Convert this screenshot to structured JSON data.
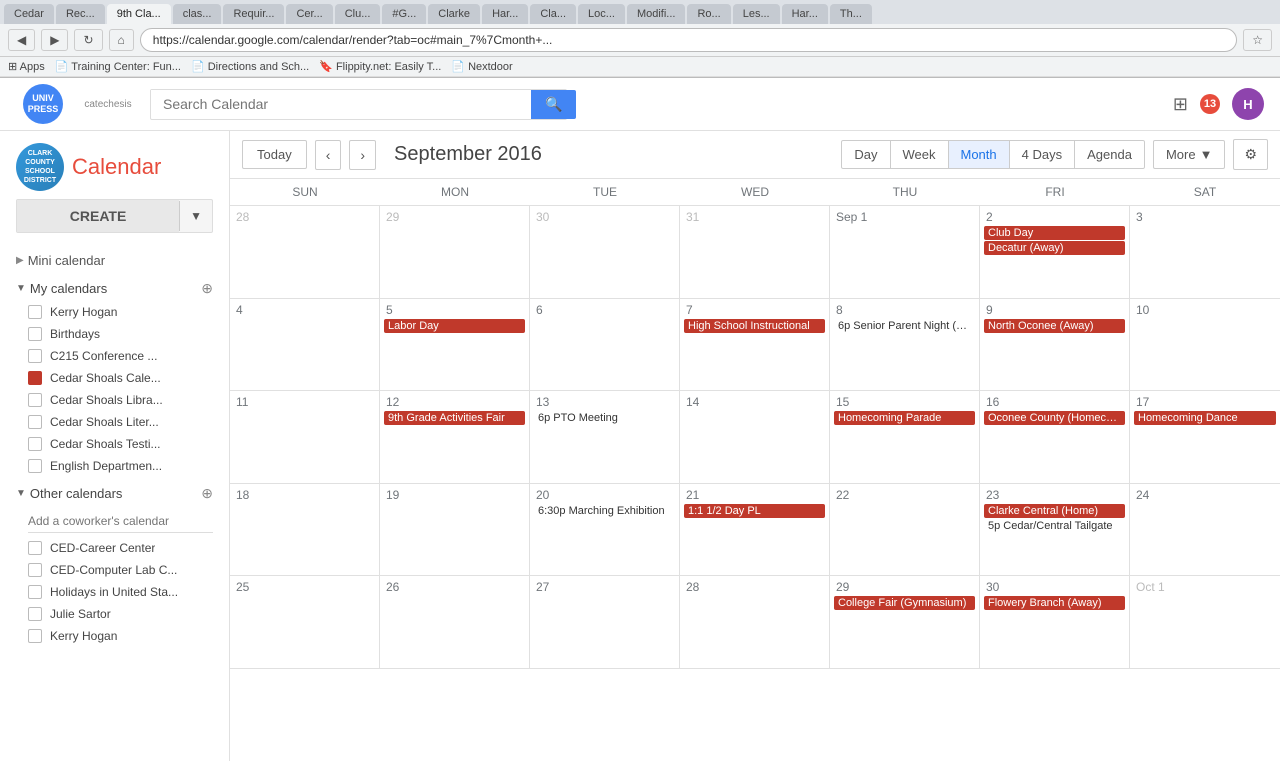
{
  "browser": {
    "url": "https://calendar.google.com/calendar/render?tab=oc#main_7%7Cmonth+...",
    "tabs": [
      {
        "label": "Cedar",
        "active": false
      },
      {
        "label": "Rec...",
        "active": false
      },
      {
        "label": "9th Cla...",
        "active": true
      },
      {
        "label": "clas...",
        "active": false
      },
      {
        "label": "Requir...",
        "active": false
      },
      {
        "label": "Cer...",
        "active": false
      },
      {
        "label": "Clu...",
        "active": false
      },
      {
        "label": "#G...",
        "active": false
      },
      {
        "label": "Clarke",
        "active": false
      },
      {
        "label": "Har...",
        "active": false
      },
      {
        "label": "Cla...",
        "active": false
      },
      {
        "label": "Loc...",
        "active": false
      },
      {
        "label": "Modifi...",
        "active": false
      },
      {
        "label": "Ro...",
        "active": false
      },
      {
        "label": "Les...",
        "active": false
      },
      {
        "label": "Har...",
        "active": false
      },
      {
        "label": "Th...",
        "active": false
      }
    ],
    "bookmarks": [
      "Apps",
      "Training Center: Fun...",
      "Directions and Sch...",
      "Flippity.net: Easily T...",
      "Nextdoor"
    ]
  },
  "topbar": {
    "search_placeholder": "Search Calendar",
    "notification_count": "13",
    "user_initial": "H"
  },
  "sidebar": {
    "logo_text": "CLARK\nCOUNTY\nSCHOOL\nDISTRICT",
    "app_title": "Calendar",
    "create_label": "CREATE",
    "mini_cal_label": "Mini calendar",
    "my_calendars_label": "My calendars",
    "my_calendars": [
      {
        "name": "Kerry Hogan",
        "checked": false,
        "color": null
      },
      {
        "name": "Birthdays",
        "checked": false,
        "color": null
      },
      {
        "name": "C215 Conference ...",
        "checked": false,
        "color": null
      },
      {
        "name": "Cedar Shoals Cale...",
        "checked": true,
        "color": "#c0392b"
      },
      {
        "name": "Cedar Shoals Libra...",
        "checked": false,
        "color": null
      },
      {
        "name": "Cedar Shoals Liter...",
        "checked": false,
        "color": null
      },
      {
        "name": "Cedar Shoals Testi...",
        "checked": false,
        "color": null
      },
      {
        "name": "English Departmen...",
        "checked": false,
        "color": null
      }
    ],
    "other_calendars_label": "Other calendars",
    "coworker_placeholder": "Add a coworker's calendar",
    "other_calendars": [
      {
        "name": "CED-Career Center",
        "checked": false,
        "color": null
      },
      {
        "name": "CED-Computer Lab C...",
        "checked": false,
        "color": null
      },
      {
        "name": "Holidays in United Sta...",
        "checked": false,
        "color": null
      },
      {
        "name": "Julie Sartor",
        "checked": false,
        "color": null
      },
      {
        "name": "Kerry Hogan",
        "checked": false,
        "color": null
      }
    ]
  },
  "calendar": {
    "toolbar": {
      "today_label": "Today",
      "month_title": "September 2016",
      "views": [
        "Day",
        "Week",
        "Month",
        "4 Days",
        "Agenda"
      ],
      "active_view": "Month",
      "more_label": "More",
      "settings_label": "⚙"
    },
    "day_headers": [
      "Sun",
      "Mon",
      "Tue",
      "Wed",
      "Thu",
      "Fri",
      "Sat"
    ],
    "weeks": [
      {
        "days": [
          {
            "date": "28",
            "other_month": true,
            "events": []
          },
          {
            "date": "29",
            "other_month": true,
            "events": []
          },
          {
            "date": "30",
            "other_month": true,
            "events": []
          },
          {
            "date": "31",
            "other_month": true,
            "events": []
          },
          {
            "date": "Sep 1",
            "other_month": false,
            "events": []
          },
          {
            "date": "2",
            "other_month": false,
            "events": [
              {
                "type": "red",
                "text": "Club Day"
              },
              {
                "type": "red",
                "text": "Decatur (Away)"
              }
            ]
          },
          {
            "date": "3",
            "other_month": false,
            "events": []
          }
        ]
      },
      {
        "days": [
          {
            "date": "4",
            "other_month": false,
            "events": []
          },
          {
            "date": "5",
            "other_month": false,
            "events": [
              {
                "type": "red",
                "text": "Labor Day"
              }
            ]
          },
          {
            "date": "6",
            "other_month": false,
            "events": []
          },
          {
            "date": "7",
            "other_month": false,
            "events": [
              {
                "type": "red",
                "text": "High School Instructional"
              }
            ]
          },
          {
            "date": "8",
            "other_month": false,
            "events": [
              {
                "type": "inline",
                "text": "6p Senior Parent Night (The..."
              }
            ]
          },
          {
            "date": "9",
            "other_month": false,
            "events": [
              {
                "type": "red",
                "text": "North Oconee (Away)"
              }
            ]
          },
          {
            "date": "10",
            "other_month": false,
            "events": []
          }
        ]
      },
      {
        "days": [
          {
            "date": "11",
            "other_month": false,
            "events": []
          },
          {
            "date": "12",
            "other_month": false,
            "events": [
              {
                "type": "red",
                "text": "9th Grade Activities Fair"
              }
            ]
          },
          {
            "date": "13",
            "other_month": false,
            "events": [
              {
                "type": "inline",
                "text": "6p PTO Meeting"
              }
            ]
          },
          {
            "date": "14",
            "other_month": false,
            "events": []
          },
          {
            "date": "15",
            "other_month": false,
            "events": [
              {
                "type": "red",
                "text": "Homecoming Parade"
              }
            ]
          },
          {
            "date": "16",
            "other_month": false,
            "events": [
              {
                "type": "red",
                "text": "Oconee County (Homeco..."
              }
            ]
          },
          {
            "date": "17",
            "other_month": false,
            "events": [
              {
                "type": "red",
                "text": "Homecoming Dance"
              }
            ]
          }
        ]
      },
      {
        "days": [
          {
            "date": "18",
            "other_month": false,
            "events": []
          },
          {
            "date": "19",
            "other_month": false,
            "events": []
          },
          {
            "date": "20",
            "other_month": false,
            "events": [
              {
                "type": "inline",
                "text": "6:30p Marching Exhibition"
              }
            ]
          },
          {
            "date": "21",
            "other_month": false,
            "events": [
              {
                "type": "red",
                "text": "1:1 1/2 Day PL"
              }
            ]
          },
          {
            "date": "22",
            "other_month": false,
            "events": []
          },
          {
            "date": "23",
            "other_month": false,
            "events": [
              {
                "type": "red",
                "text": "Clarke Central (Home)"
              },
              {
                "type": "inline",
                "text": "5p Cedar/Central Tailgate"
              }
            ]
          },
          {
            "date": "24",
            "other_month": false,
            "events": []
          }
        ]
      },
      {
        "days": [
          {
            "date": "25",
            "other_month": false,
            "events": []
          },
          {
            "date": "26",
            "other_month": false,
            "events": []
          },
          {
            "date": "27",
            "other_month": false,
            "events": []
          },
          {
            "date": "28",
            "other_month": false,
            "events": []
          },
          {
            "date": "29",
            "other_month": false,
            "events": [
              {
                "type": "red",
                "text": "College Fair (Gymnasium)"
              }
            ]
          },
          {
            "date": "30",
            "other_month": false,
            "events": [
              {
                "type": "red",
                "text": "Flowery Branch (Away)"
              }
            ]
          },
          {
            "date": "Oct 1",
            "other_month": true,
            "events": []
          }
        ]
      }
    ]
  }
}
